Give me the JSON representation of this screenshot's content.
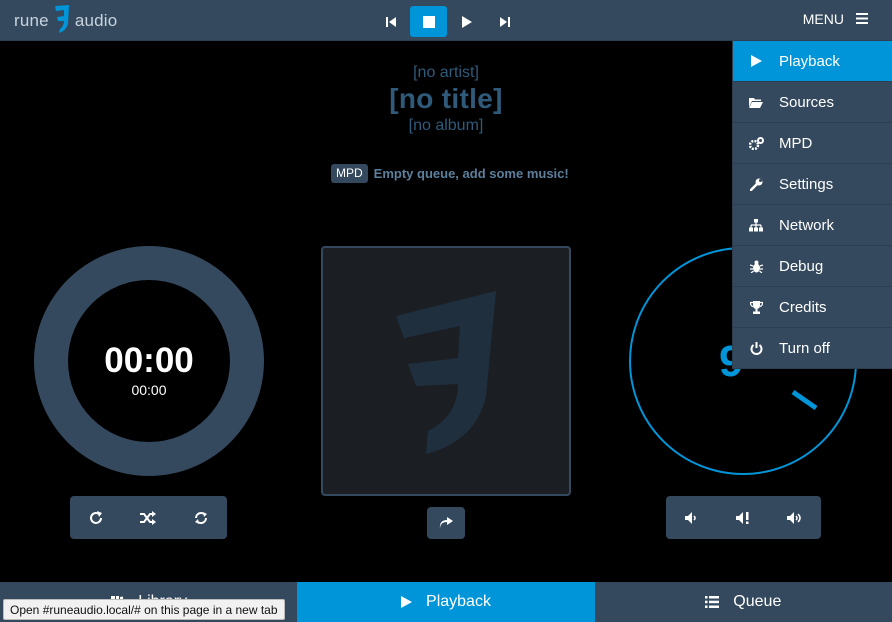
{
  "header": {
    "logo_left": "rune",
    "logo_right": "audio",
    "menu_label": "MENU"
  },
  "transport": {
    "buttons": [
      "previous-icon",
      "stop-icon",
      "play-icon",
      "next-icon"
    ],
    "active": "stop"
  },
  "track": {
    "artist": "[no artist]",
    "title": "[no title]",
    "album": "[no album]"
  },
  "status": {
    "badge": "MPD",
    "message": "Empty queue, add some music!"
  },
  "time": {
    "elapsed": "00:00",
    "total": "00:00"
  },
  "playback_controls": [
    "repeat-icon",
    "shuffle-icon",
    "single-icon"
  ],
  "volume_controls": [
    "volume-down-icon",
    "mute-icon",
    "volume-up-icon"
  ],
  "menu": {
    "items": [
      {
        "label": "Playback",
        "icon": "play-icon",
        "active": true
      },
      {
        "label": "Sources",
        "icon": "folder-icon",
        "active": false
      },
      {
        "label": "MPD",
        "icon": "cogs-icon",
        "active": false
      },
      {
        "label": "Settings",
        "icon": "wrench-icon",
        "active": false
      },
      {
        "label": "Network",
        "icon": "sitemap-icon",
        "active": false
      },
      {
        "label": "Debug",
        "icon": "bug-icon",
        "active": false
      },
      {
        "label": "Credits",
        "icon": "trophy-icon",
        "active": false
      },
      {
        "label": "Turn off",
        "icon": "power-icon",
        "active": false
      }
    ]
  },
  "bottom_tabs": [
    {
      "label": "Library",
      "icon": "library-icon",
      "active": false
    },
    {
      "label": "Playback",
      "icon": "play-icon",
      "active": true
    },
    {
      "label": "Queue",
      "icon": "list-icon",
      "active": false
    }
  ],
  "tooltip": "Open #runeaudio.local/# on this page in a new tab",
  "colors": {
    "accent": "#0095d8",
    "panel": "#34495e",
    "muted_text": "#2f5a7a"
  }
}
